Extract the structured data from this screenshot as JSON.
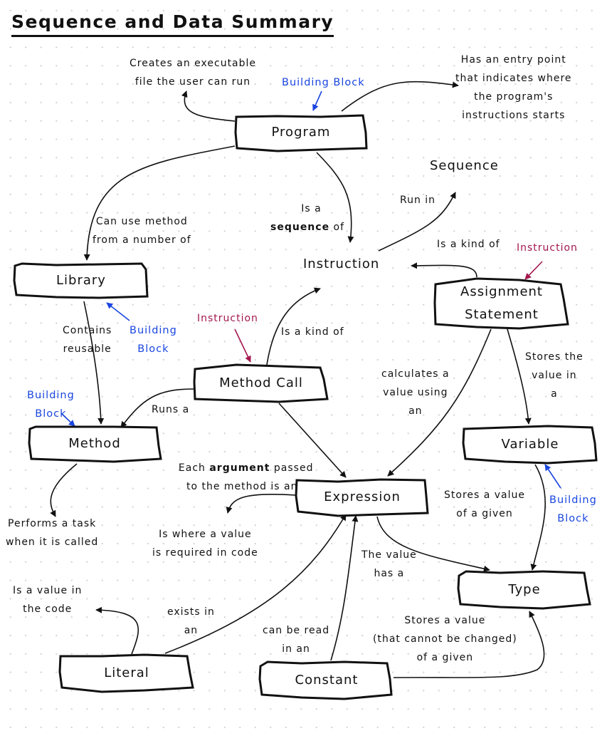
{
  "title": "Sequence and Data Summary",
  "colors": {
    "ink": "#111111",
    "building_block": "#1a46e0",
    "instruction_tag": "#a3184f",
    "background": "#ffffff",
    "grid_dot": "#d4d4d4"
  },
  "nodes": {
    "program": "Program",
    "library": "Library",
    "method": "Method",
    "method_call": "Method Call",
    "assignment_statement": "Assignment\nStatement",
    "variable": "Variable",
    "expression": "Expression",
    "type": "Type",
    "literal": "Literal",
    "constant": "Constant",
    "instruction": "Instruction",
    "sequence": "Sequence"
  },
  "edge_labels": {
    "program_creates": "Creates an executable\nfile the user can run",
    "program_entry": "Has an entry point\nthat indicates where\nthe program's\ninstructions starts",
    "program_sequence_line1": "Is a",
    "program_sequence_bold": "sequence",
    "program_sequence_tail": " of",
    "program_library": "Can use method\nfrom a number of",
    "instruction_sequence": "Run in",
    "assignment_kind_of": "Is a kind of",
    "method_call_kind_of": "Is a kind of",
    "library_contains": "Contains\nreusable",
    "method_call_runs": "Runs a",
    "argument_prefix": "Each ",
    "argument_bold": "argument",
    "argument_suffix": " passed\nto the method is an",
    "assignment_calculates": "calculates a\nvalue using\nan",
    "assignment_stores": "Stores the\nvalue in\na",
    "method_performs": "Performs a task\nwhen it is called",
    "expression_where": "Is where a value\nis required in code",
    "variable_stores": "Stores a value\nof a given",
    "expression_type": "The value\nhas a",
    "literal_is": "Is a value in\nthe code",
    "literal_exists": "exists in\nan",
    "constant_read": "can be read\nin an",
    "constant_stores": "Stores a value\n(that cannot be changed)\nof a given"
  },
  "annotations": {
    "building_block_program": "Building Block",
    "building_block_library": "Building\nBlock",
    "building_block_method": "Building\nBlock",
    "building_block_variable": "Building\nBlock",
    "instruction_method_call": "Instruction",
    "instruction_assignment": "Instruction"
  }
}
